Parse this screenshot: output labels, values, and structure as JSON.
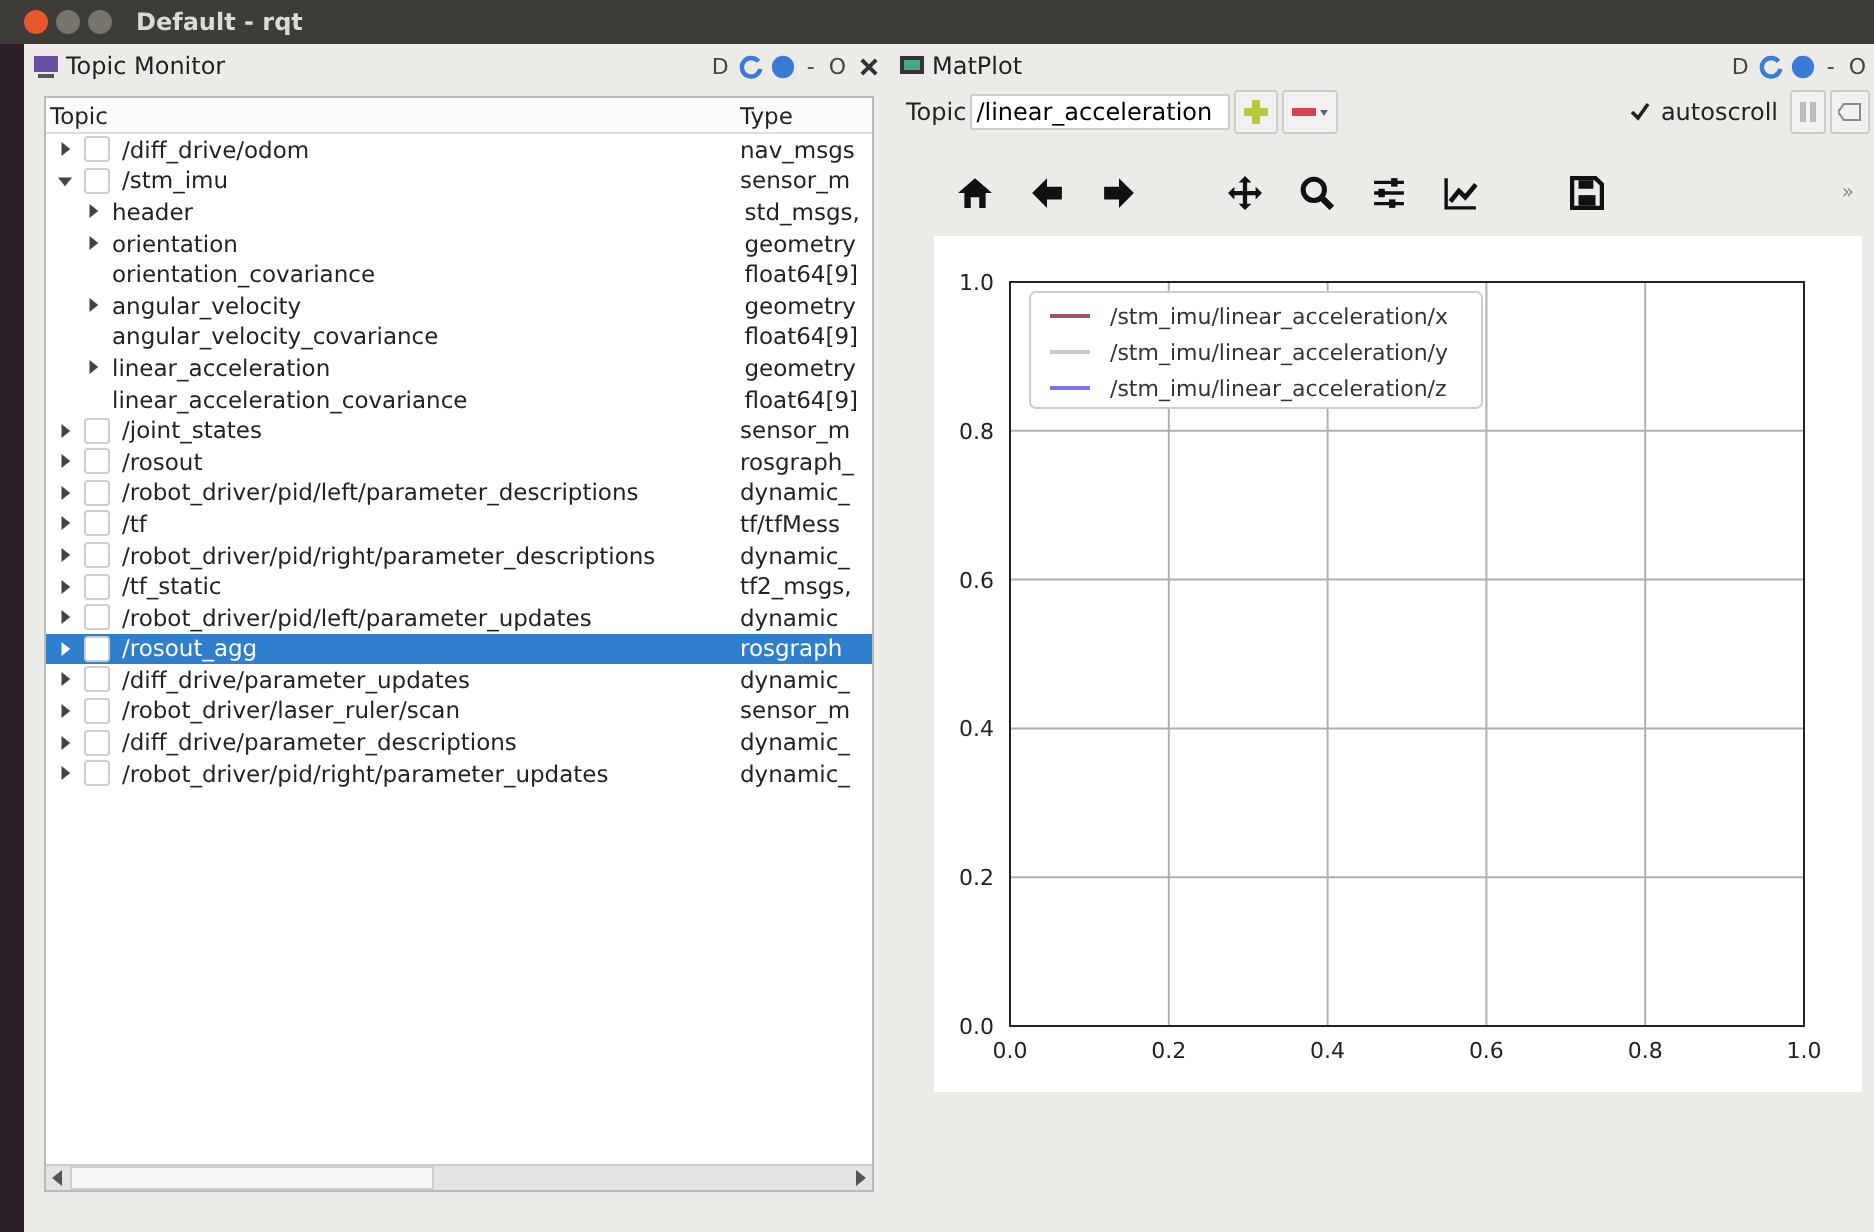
{
  "window": {
    "title": "Default - rqt"
  },
  "topic_monitor": {
    "title": "Topic Monitor",
    "header_controls": {
      "d": "D",
      "minus": "-",
      "o": "O"
    },
    "columns": [
      "Topic",
      "Type"
    ],
    "topics": [
      {
        "name": "/diff_drive/odom",
        "type": "nav_msgs",
        "checked": false,
        "expanded": false,
        "selected": false
      },
      {
        "name": "/stm_imu",
        "type": "sensor_m",
        "checked": false,
        "expanded": true,
        "selected": false,
        "children": [
          {
            "name": "header",
            "type": "std_msgs,",
            "expandable": true
          },
          {
            "name": "orientation",
            "type": "geometry",
            "expandable": true
          },
          {
            "name": "orientation_covariance",
            "type": "float64[9]",
            "expandable": false
          },
          {
            "name": "angular_velocity",
            "type": "geometry",
            "expandable": true
          },
          {
            "name": "angular_velocity_covariance",
            "type": "float64[9]",
            "expandable": false
          },
          {
            "name": "linear_acceleration",
            "type": "geometry",
            "expandable": true
          },
          {
            "name": "linear_acceleration_covariance",
            "type": "float64[9]",
            "expandable": false
          }
        ]
      },
      {
        "name": "/joint_states",
        "type": "sensor_m",
        "checked": false,
        "expanded": false,
        "selected": false
      },
      {
        "name": "/rosout",
        "type": "rosgraph_",
        "checked": false,
        "expanded": false,
        "selected": false
      },
      {
        "name": "/robot_driver/pid/left/parameter_descriptions",
        "type": "dynamic_",
        "checked": false,
        "expanded": false,
        "selected": false
      },
      {
        "name": "/tf",
        "type": "tf/tfMess",
        "checked": false,
        "expanded": false,
        "selected": false
      },
      {
        "name": "/robot_driver/pid/right/parameter_descriptions",
        "type": "dynamic_",
        "checked": false,
        "expanded": false,
        "selected": false
      },
      {
        "name": "/tf_static",
        "type": "tf2_msgs,",
        "checked": false,
        "expanded": false,
        "selected": false
      },
      {
        "name": "/robot_driver/pid/left/parameter_updates",
        "type": "dynamic",
        "checked": false,
        "expanded": false,
        "selected": false
      },
      {
        "name": "/rosout_agg",
        "type": "rosgraph",
        "checked": false,
        "expanded": false,
        "selected": true
      },
      {
        "name": "/diff_drive/parameter_updates",
        "type": "dynamic_",
        "checked": false,
        "expanded": false,
        "selected": false
      },
      {
        "name": "/robot_driver/laser_ruler/scan",
        "type": "sensor_m",
        "checked": false,
        "expanded": false,
        "selected": false
      },
      {
        "name": "/diff_drive/parameter_descriptions",
        "type": "dynamic_",
        "checked": false,
        "expanded": false,
        "selected": false
      },
      {
        "name": "/robot_driver/pid/right/parameter_updates",
        "type": "dynamic_",
        "checked": false,
        "expanded": false,
        "selected": false
      }
    ]
  },
  "matplot": {
    "title": "MatPlot",
    "header_controls": {
      "d": "D",
      "minus": "-",
      "o": "O"
    },
    "topic_label": "Topic",
    "topic_value": "/linear_acceleration",
    "autoscroll": {
      "label": "autoscroll",
      "checked": true
    },
    "more": "»",
    "legend": [
      {
        "label": "/stm_imu/linear_acceleration/x",
        "color": "#a0525a"
      },
      {
        "label": "/stm_imu/linear_acceleration/y",
        "color": "#c8c8c8"
      },
      {
        "label": "/stm_imu/linear_acceleration/z",
        "color": "#7a78f0"
      }
    ],
    "chart_data": {
      "type": "line",
      "grid": true,
      "xlim": [
        0,
        1
      ],
      "ylim": [
        0,
        1
      ],
      "xticks": [
        {
          "value": 0,
          "label": "0.0"
        },
        {
          "value": 0.2,
          "label": "0.2"
        },
        {
          "value": 0.4,
          "label": "0.4"
        },
        {
          "value": 0.6,
          "label": "0.6"
        },
        {
          "value": 0.8,
          "label": "0.8"
        },
        {
          "value": 1,
          "label": "1.0"
        }
      ],
      "yticks": [
        {
          "value": 0,
          "label": "0.0"
        },
        {
          "value": 0.2,
          "label": "0.2"
        },
        {
          "value": 0.4,
          "label": "0.4"
        },
        {
          "value": 0.6,
          "label": "0.6"
        },
        {
          "value": 0.8,
          "label": "0.8"
        },
        {
          "value": 1,
          "label": "1.0"
        }
      ]
    }
  }
}
